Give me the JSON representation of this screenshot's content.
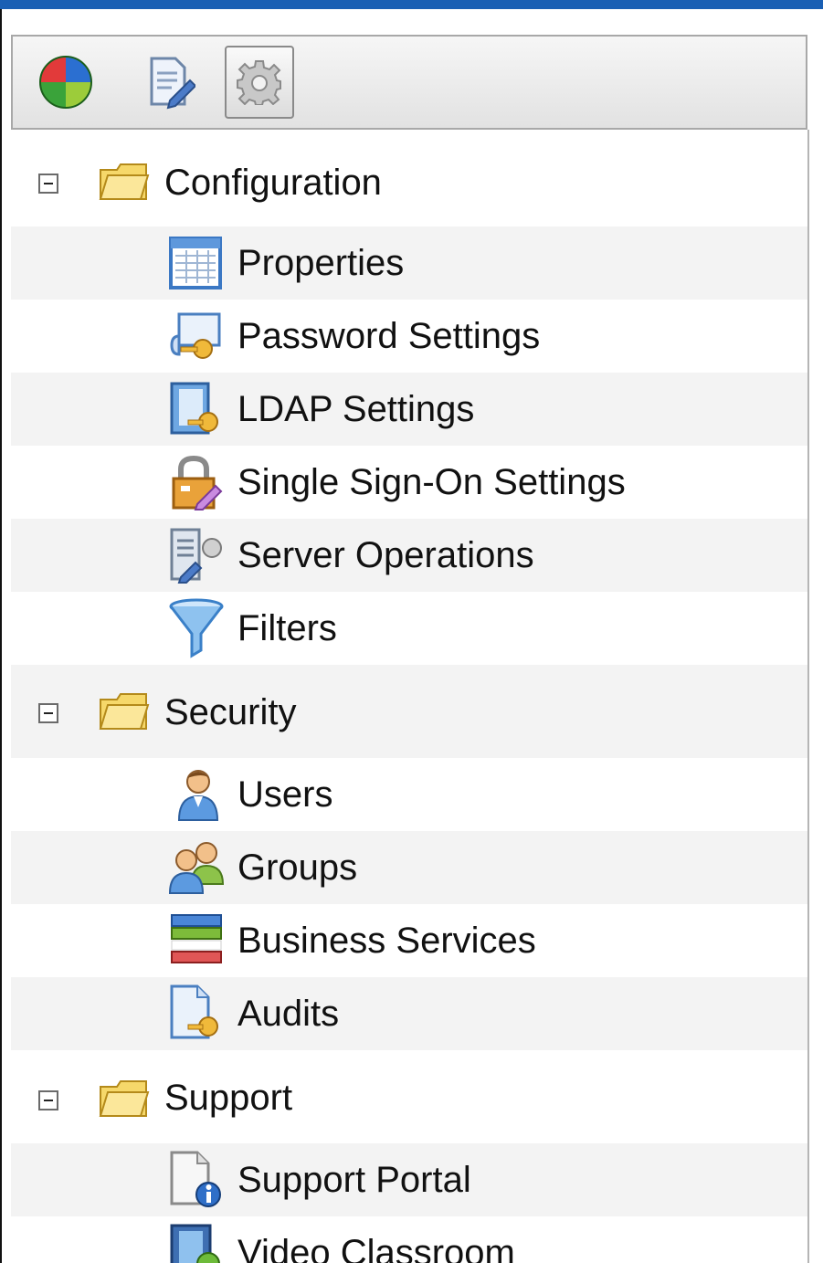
{
  "toolbar": {
    "buttons": [
      {
        "icon": "pie-chart-icon",
        "selected": false
      },
      {
        "icon": "edit-document-icon",
        "selected": false
      },
      {
        "icon": "gear-icon",
        "selected": true
      }
    ]
  },
  "tree": {
    "groups": [
      {
        "label": "Configuration",
        "expanded": true,
        "items": [
          {
            "label": "Properties",
            "icon": "table-properties-icon"
          },
          {
            "label": "Password Settings",
            "icon": "key-script-icon"
          },
          {
            "label": "LDAP Settings",
            "icon": "ldap-key-icon"
          },
          {
            "label": "Single Sign-On Settings",
            "icon": "padlock-edit-icon"
          },
          {
            "label": "Server Operations",
            "icon": "server-edit-icon"
          },
          {
            "label": "Filters",
            "icon": "funnel-icon"
          }
        ]
      },
      {
        "label": "Security",
        "expanded": true,
        "items": [
          {
            "label": "Users",
            "icon": "user-icon"
          },
          {
            "label": "Groups",
            "icon": "group-icon"
          },
          {
            "label": "Business Services",
            "icon": "stacked-bars-icon"
          },
          {
            "label": "Audits",
            "icon": "document-key-icon"
          }
        ]
      },
      {
        "label": "Support",
        "expanded": true,
        "items": [
          {
            "label": "Support Portal",
            "icon": "document-info-icon"
          },
          {
            "label": "Video Classroom",
            "icon": "video-classroom-icon"
          }
        ]
      }
    ]
  }
}
